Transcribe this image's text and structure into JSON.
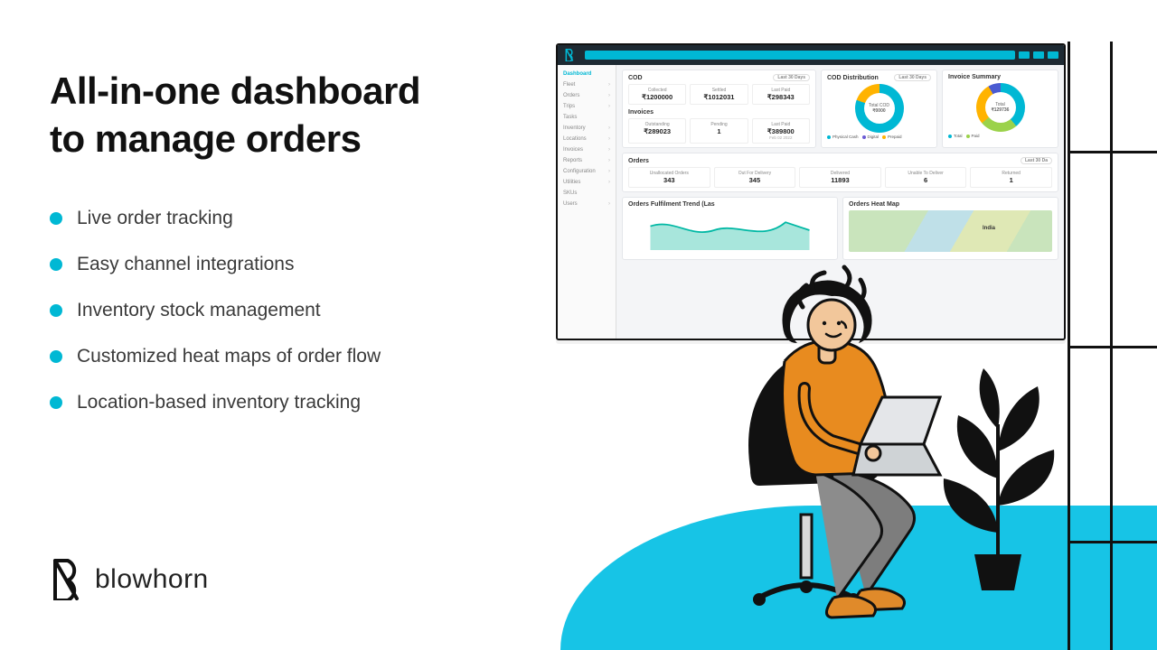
{
  "headline_l1": "All-in-one dashboard",
  "headline_l2": "to manage orders",
  "features": {
    "f1": "Live order tracking",
    "f2": "Easy channel integrations",
    "f3": "Inventory stock management",
    "f4": "Customized heat maps of order flow",
    "f5": "Location-based inventory tracking"
  },
  "brand": {
    "name": "blowhorn"
  },
  "dashboard": {
    "period_label": "Last 30 Days",
    "sidebar": {
      "items": [
        "Dashboard",
        "Fleet",
        "Orders",
        "Trips",
        "Tasks",
        "Inventory",
        "Locations",
        "Invoices",
        "Reports",
        "Configuration",
        "Utilities",
        "SKUs",
        "Users"
      ]
    },
    "cod": {
      "title": "COD",
      "collected": {
        "label": "Collected",
        "value": "₹1200000"
      },
      "settled": {
        "label": "Settled",
        "value": "₹1012031"
      },
      "last_paid": {
        "label": "Last Paid",
        "value": "₹298343"
      }
    },
    "invoices": {
      "title": "Invoices",
      "outstanding": {
        "label": "Outstanding",
        "value": "₹289023"
      },
      "pending": {
        "label": "Pending",
        "value": "1"
      },
      "last_paid": {
        "label": "Last Paid",
        "value": "₹389800",
        "sub": "Feb 02 2022"
      }
    },
    "cod_dist": {
      "title": "COD Distribution",
      "center_label": "Total COD",
      "center_value": "₹0000",
      "legend": {
        "cash": "Physical Cash",
        "digital": "Digital",
        "prepaid": "Prepaid"
      }
    },
    "inv_summary": {
      "title": "Invoice Summary",
      "center_label": "Total",
      "center_value": "₹129736",
      "legend": {
        "total": "Total",
        "paid": "Paid"
      }
    },
    "orders": {
      "title": "Orders",
      "period": "Last 30 Da",
      "unallocated": {
        "label": "Unallocated Orders",
        "value": "343"
      },
      "out": {
        "label": "Out For Delivery",
        "value": "345"
      },
      "delivered": {
        "label": "Delivered",
        "value": "11893"
      },
      "unable": {
        "label": "Unable To Deliver",
        "value": "6"
      },
      "returned": {
        "label": "Returned",
        "value": "1"
      }
    },
    "trend": {
      "title": "Orders Fulfilment Trend (Las"
    },
    "heatmap": {
      "title": "Orders Heat Map",
      "country": "India"
    }
  }
}
